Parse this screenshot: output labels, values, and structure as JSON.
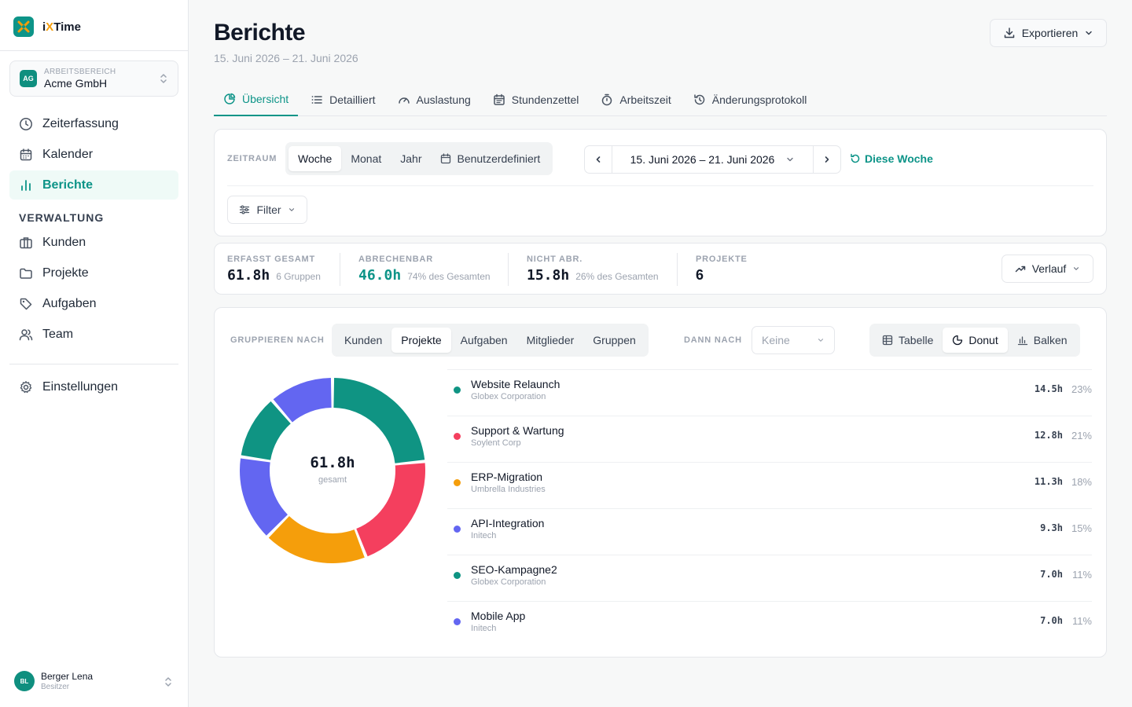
{
  "app": {
    "name_prefix": "i",
    "name_x": "X",
    "name_suffix": "Time"
  },
  "workspace": {
    "badge": "AG",
    "label": "ARBEITSBEREICH",
    "name": "Acme GmbH"
  },
  "nav": {
    "items": [
      {
        "label": "Zeiterfassung",
        "icon": "clock-icon"
      },
      {
        "label": "Kalender",
        "icon": "calendar-icon"
      },
      {
        "label": "Berichte",
        "icon": "bar-chart-icon",
        "active": true
      }
    ],
    "section": "VERWALTUNG",
    "admin_items": [
      {
        "label": "Kunden",
        "icon": "briefcase-icon"
      },
      {
        "label": "Projekte",
        "icon": "folder-icon"
      },
      {
        "label": "Aufgaben",
        "icon": "tag-icon"
      },
      {
        "label": "Team",
        "icon": "users-icon"
      }
    ],
    "settings": "Einstellungen"
  },
  "user": {
    "initials": "BL",
    "name": "Berger Lena",
    "role": "Besitzer"
  },
  "page": {
    "title": "Berichte",
    "subtitle": "15. Juni 2026 – 21. Juni 2026",
    "export_label": "Exportieren"
  },
  "tabs": [
    {
      "label": "Übersicht",
      "icon": "pie-icon",
      "active": true
    },
    {
      "label": "Detailliert",
      "icon": "list-icon"
    },
    {
      "label": "Auslastung",
      "icon": "gauge-icon"
    },
    {
      "label": "Stundenzettel",
      "icon": "calendar-icon"
    },
    {
      "label": "Arbeitszeit",
      "icon": "stopwatch-icon"
    },
    {
      "label": "Änderungsprotokoll",
      "icon": "history-icon"
    }
  ],
  "filters": {
    "period_label": "ZEITRAUM",
    "periods": [
      "Woche",
      "Monat",
      "Jahr",
      "Benutzerdefiniert"
    ],
    "active_period": "Woche",
    "range": "15. Juni 2026 – 21. Juni 2026",
    "this_week": "Diese Woche",
    "filter_label": "Filter"
  },
  "stats": {
    "total": {
      "label": "ERFASST GESAMT",
      "value": "61.8h",
      "sub": "6 Gruppen"
    },
    "billable": {
      "label": "ABRECHENBAR",
      "value": "46.0h",
      "sub": "74% des Gesamten"
    },
    "nonbillable": {
      "label": "NICHT ABR.",
      "value": "15.8h",
      "sub": "26% des Gesamten"
    },
    "projects": {
      "label": "PROJEKTE",
      "value": "6"
    },
    "trend_label": "Verlauf"
  },
  "grouping": {
    "label": "GRUPPIEREN NACH",
    "options": [
      "Kunden",
      "Projekte",
      "Aufgaben",
      "Mitglieder",
      "Gruppen"
    ],
    "active": "Projekte",
    "then_label": "DANN NACH",
    "then_value": "Keine",
    "views": [
      "Tabelle",
      "Donut",
      "Balken"
    ],
    "active_view": "Donut"
  },
  "chart_data": {
    "type": "pie",
    "center_value": "61.8h",
    "center_label": "gesamt",
    "categories": [
      "Website Relaunch",
      "Support & Wartung",
      "ERP-Migration",
      "API-Integration",
      "SEO-Kampagne2",
      "Mobile App"
    ],
    "clients": [
      "Globex Corporation",
      "Soylent Corp",
      "Umbrella Industries",
      "Initech",
      "Globex Corporation",
      "Initech"
    ],
    "values": [
      14.5,
      12.8,
      11.3,
      9.3,
      7.0,
      7.0
    ],
    "hours_labels": [
      "14.5h",
      "12.8h",
      "11.3h",
      "9.3h",
      "7.0h",
      "7.0h"
    ],
    "percent_labels": [
      "23%",
      "21%",
      "18%",
      "15%",
      "11%",
      "11%"
    ],
    "colors": [
      "#0f9483",
      "#f43f5e",
      "#f59e0b",
      "#6366f1",
      "#0f9483",
      "#6366f1"
    ]
  }
}
